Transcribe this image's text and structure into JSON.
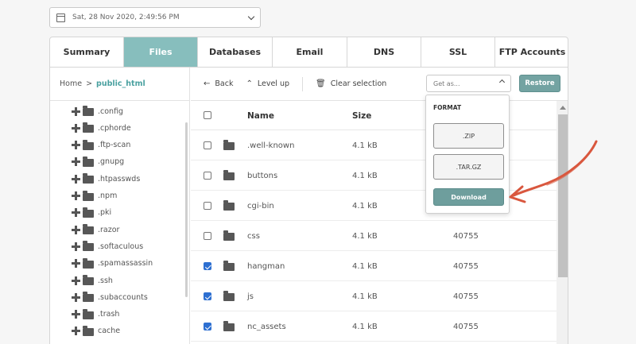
{
  "date_picker": {
    "value": "Sat, 28 Nov 2020, 2:49:56 PM"
  },
  "tabs": [
    {
      "label": "Summary",
      "active": false,
      "width": 93
    },
    {
      "label": "Files",
      "active": true,
      "width": 93
    },
    {
      "label": "Databases",
      "active": false,
      "width": 94
    },
    {
      "label": "Email",
      "active": false,
      "width": 94
    },
    {
      "label": "DNS",
      "active": false,
      "width": 93
    },
    {
      "label": "SSL",
      "active": false,
      "width": 93
    },
    {
      "label": "FTP Accounts",
      "active": false,
      "width": 93
    }
  ],
  "breadcrumb": {
    "home": "Home",
    "separator": ">",
    "current": "public_html"
  },
  "tree": [
    ".config",
    ".cphorde",
    ".ftp-scan",
    ".gnupg",
    ".htpasswds",
    ".npm",
    ".pki",
    ".razor",
    ".softaculous",
    ".spamassassin",
    ".ssh",
    ".subaccounts",
    ".trash",
    "cache"
  ],
  "toolbar": {
    "back": "Back",
    "level_up": "Level up",
    "clear_selection": "Clear selection",
    "get_as_placeholder": "Get as...",
    "restore": "Restore"
  },
  "table": {
    "headers": {
      "name": "Name",
      "size": "Size"
    },
    "rows": [
      {
        "name": ".well-known",
        "size": "4.1 kB",
        "perm": "",
        "checked": false
      },
      {
        "name": "buttons",
        "size": "4.1 kB",
        "perm": "",
        "checked": false
      },
      {
        "name": "cgi-bin",
        "size": "4.1 kB",
        "perm": "",
        "checked": false
      },
      {
        "name": "css",
        "size": "4.1 kB",
        "perm": "40755",
        "checked": false
      },
      {
        "name": "hangman",
        "size": "4.1 kB",
        "perm": "40755",
        "checked": true
      },
      {
        "name": "js",
        "size": "4.1 kB",
        "perm": "40755",
        "checked": true
      },
      {
        "name": "nc_assets",
        "size": "4.1 kB",
        "perm": "40755",
        "checked": true
      }
    ]
  },
  "format_menu": {
    "title": "FORMAT",
    "zip": ".ZIP",
    "targz": ".TAR.GZ",
    "download": "Download"
  },
  "colors": {
    "accent": "#87bebd",
    "restore": "#73a3a2",
    "checkbox": "#2d6fd1",
    "annotation_arrow": "#d9573e"
  },
  "icons": {
    "date": "calendar-icon",
    "back": "arrow-left-icon",
    "level_up": "chevron-up-icon",
    "clear": "trash-icon",
    "folder": "folder-icon",
    "expand": "plus-icon"
  }
}
